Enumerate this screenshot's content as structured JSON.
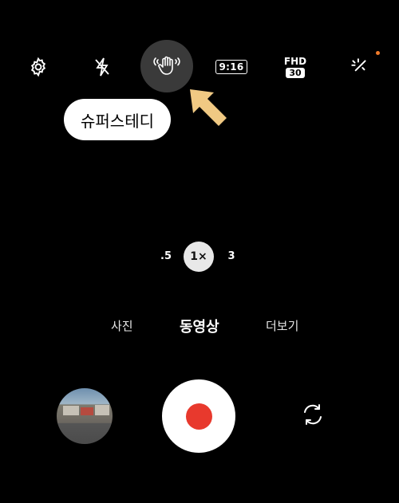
{
  "toolbar": {
    "settings_icon": "gear-icon",
    "flash_icon": "flash-off-icon",
    "steady_icon": "hand-shake-icon",
    "ratio_label": "9:16",
    "quality_top": "FHD",
    "quality_fps": "30",
    "effects_icon": "sparkle-icon",
    "notification_color": "#f07a2a"
  },
  "tooltip": {
    "text": "슈퍼스테디"
  },
  "zoom": {
    "options": [
      ".5",
      "1×",
      "3"
    ],
    "selected": "1×"
  },
  "modes": {
    "items": [
      "사진",
      "동영상",
      "더보기"
    ],
    "active": "동영상"
  },
  "controls": {
    "gallery_icon": "gallery-thumbnail",
    "record_icon": "record-icon",
    "record_color": "#e8392d",
    "switch_icon": "switch-camera-icon"
  }
}
